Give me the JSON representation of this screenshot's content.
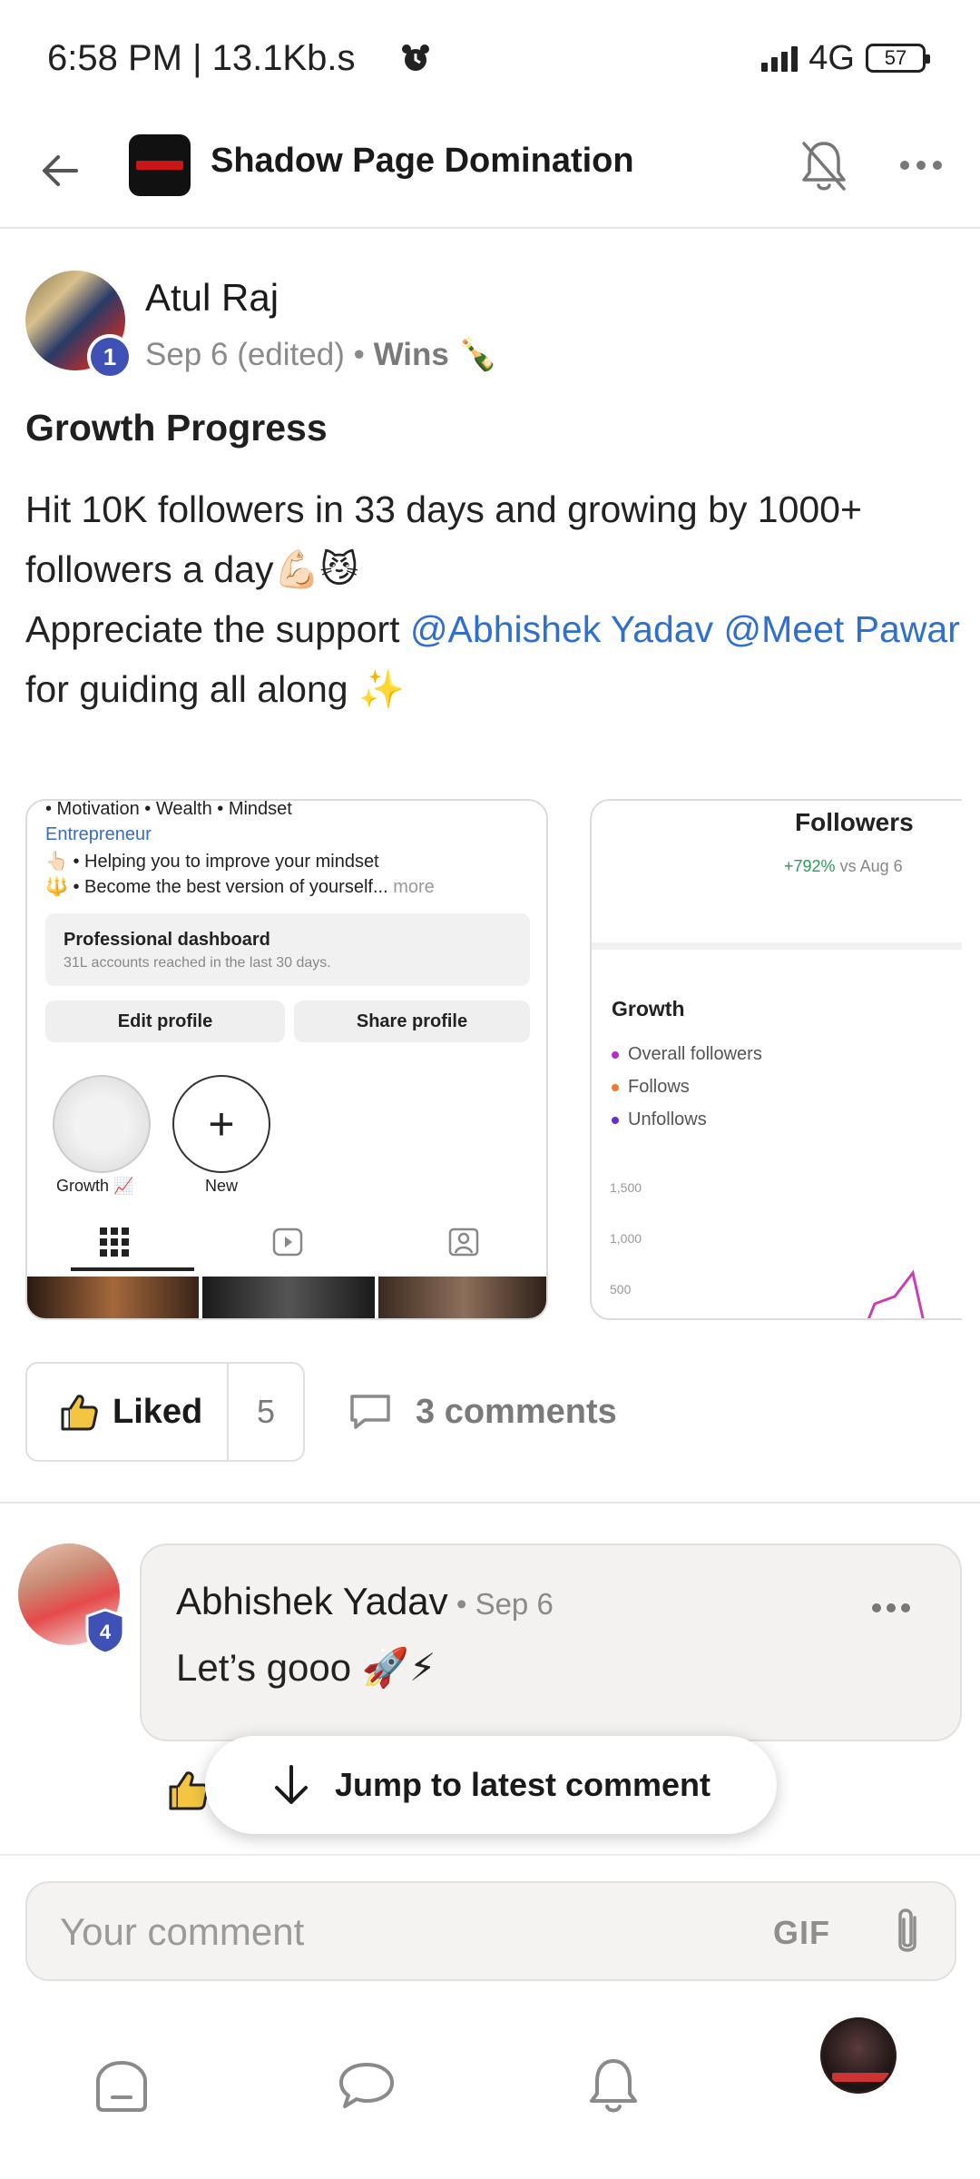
{
  "status_bar": {
    "time": "6:58 PM | 13.1Kb.s",
    "network": "4G",
    "battery": "57"
  },
  "header": {
    "title": "Shadow Page Domination"
  },
  "post": {
    "author": "Atul Raj",
    "author_badge": "1",
    "date": "Sep 6 (edited)",
    "separator": " • ",
    "category": "Wins 🍾",
    "title": "Growth Progress",
    "body_line1": "Hit 10K followers in 33 days and growing by 1000+ followers a day💪🏻😼",
    "body_line2_prefix": "Appreciate the support ",
    "mention1": "@Abhishek Yadav",
    "mention2": "@Meet Pawar",
    "body_line2_suffix": " for guiding all along ✨"
  },
  "image1": {
    "line1": "• Motivation • Wealth • Mindset",
    "line2": "Entrepreneur",
    "line3": "👆🏻 • Helping you to improve your mindset",
    "line4_prefix": "🔱 • Become the best version of yourself...",
    "line4_more": " more",
    "dash_title": "Professional dashboard",
    "dash_sub": "31L accounts reached in the last 30 days.",
    "edit_profile": "Edit profile",
    "share_profile": "Share profile",
    "highlight1_label": "Growth 📈",
    "highlight2_label": "New",
    "highlight2_symbol": "+"
  },
  "image2": {
    "title": "Followers",
    "delta": "+792%",
    "delta_suffix": " vs Aug 6",
    "growth": "Growth",
    "legend": [
      "Overall followers",
      "Follows",
      "Unfollows"
    ],
    "legend_colors": [
      "#b02fc9",
      "#f07a2b",
      "#6a2fc9"
    ],
    "ticks": [
      "1,500",
      "1,000",
      "500"
    ]
  },
  "actions": {
    "like_label": "Liked",
    "like_count": "5",
    "comments_label": "3 comments"
  },
  "comment": {
    "author": "Abhishek Yadav",
    "badge": "4",
    "date_sep": " • ",
    "date": "Sep 6",
    "text": "Let’s gooo 🚀⚡"
  },
  "jump": {
    "label": "Jump to latest comment"
  },
  "composer": {
    "placeholder": "Your comment",
    "gif": "GIF"
  },
  "colors": {
    "accent_blue": "#2f6fce",
    "badge_blue": "#4051b5"
  }
}
